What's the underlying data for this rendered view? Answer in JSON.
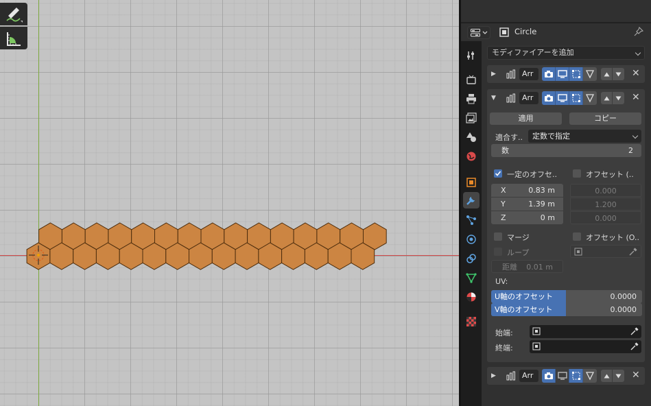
{
  "properties": {
    "object_name": "Circle",
    "add_modifier": "モディファイアーを追加",
    "modifiers": [
      {
        "name": "Arr",
        "expanded": false
      },
      {
        "name": "Arr",
        "expanded": true
      },
      {
        "name": "Arr",
        "expanded": false
      }
    ],
    "array": {
      "apply_label": "適用",
      "copy_label": "コピー",
      "fit_type_label": "適合す..",
      "fit_type_value": "定数で指定",
      "count_label": "数",
      "count_value": "2",
      "constant_offset_label": "一定のオフセ..",
      "relative_offset_label": "オフセット (..",
      "x_label": "X",
      "x_value": "0.83 m",
      "y_label": "Y",
      "y_value": "1.39 m",
      "z_label": "Z",
      "z_value": "0 m",
      "rel_x": "0.000",
      "rel_y": "1.200",
      "rel_z": "0.000",
      "merge_label": "マージ",
      "object_offset_label": "オフセット (O..",
      "loop_label": "ループ",
      "distance_label": "距離",
      "distance_value": "0.01 m",
      "uv_label": "UV:",
      "u_offset_label": "U軸のオフセット",
      "u_offset_value": "0.0000",
      "v_offset_label": "V軸のオフセット",
      "v_offset_value": "0.0000",
      "start_cap_label": "始端:",
      "end_cap_label": "終端:"
    }
  },
  "colors": {
    "accent": "#4772b3",
    "hex_fill": "#cc8542",
    "hex_edge": "#e8962e",
    "axis_x": "#d14a4a",
    "axis_y": "#7ba83d"
  },
  "icons": [
    "annotate-icon",
    "measure-icon",
    "editor-type-icon",
    "object-data-icon",
    "pin-icon",
    "tool-tab-icon",
    "render-tab-icon",
    "output-tab-icon",
    "view-layer-tab-icon",
    "scene-tab-icon",
    "world-tab-icon",
    "object-tab-icon",
    "modifier-tab-icon",
    "particles-tab-icon",
    "physics-tab-icon",
    "constraints-tab-icon",
    "data-tab-icon",
    "material-tab-icon",
    "texture-tab-icon",
    "eyedropper-icon"
  ]
}
